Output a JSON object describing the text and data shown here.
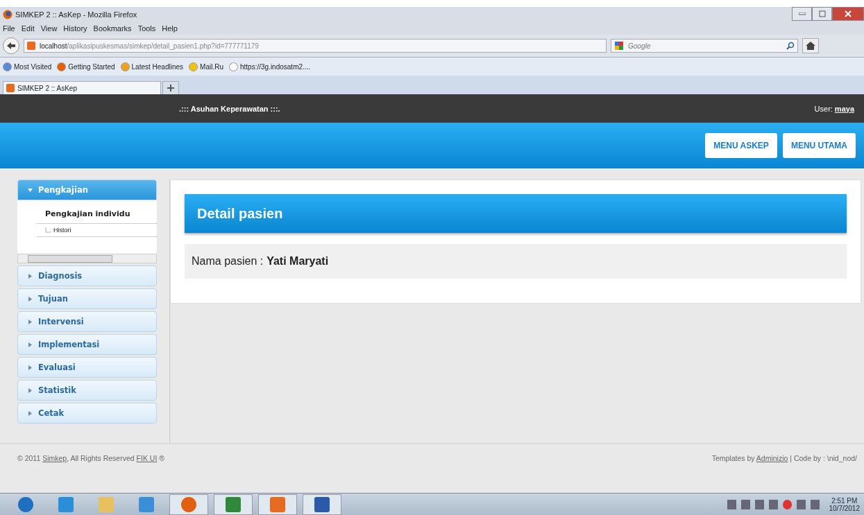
{
  "window": {
    "title": "SIMKEP 2 :: AsKep - Mozilla Firefox"
  },
  "menu": [
    "File",
    "Edit",
    "View",
    "History",
    "Bookmarks",
    "Tools",
    "Help"
  ],
  "address": {
    "host": "localhost",
    "path": "/aplikasipuskesmas/simkep/detail_pasien1.php?id=777771179"
  },
  "search": {
    "placeholder": "Google"
  },
  "bookmarks": [
    "Most Visited",
    "Getting Started",
    "Latest Headlines",
    "Mail.Ru",
    "https://3g.indosatm2...."
  ],
  "tabs": [
    {
      "label": "SIMKEP 2 :: AsKep",
      "selected": true
    }
  ],
  "header": {
    "title": ".::: Asuhan Keperawatan :::.",
    "user_label": "User:",
    "user": "maya"
  },
  "buttons": [
    "MENU ASKEP",
    "MENU UTAMA"
  ],
  "sidebar": {
    "sections": [
      {
        "label": "Pengkajian",
        "expanded": true,
        "children": [
          {
            "label": "Pengkajian individu",
            "children": [
              {
                "label": "Histori"
              }
            ]
          }
        ]
      },
      {
        "label": "Diagnosis",
        "expanded": false
      },
      {
        "label": "Tujuan",
        "expanded": false
      },
      {
        "label": "Intervensi",
        "expanded": false
      },
      {
        "label": "Implementasi",
        "expanded": false
      },
      {
        "label": "Evaluasi",
        "expanded": false
      },
      {
        "label": "Statistik",
        "expanded": false
      },
      {
        "label": "Cetak",
        "expanded": false
      }
    ]
  },
  "panel": {
    "title": "Detail pasien",
    "field_label": "Nama pasien :",
    "field_value": "Yati Maryati"
  },
  "footer": {
    "left": [
      {
        "kind": "text",
        "text": "© 2011 "
      },
      {
        "kind": "link",
        "text": "Simkep"
      },
      {
        "kind": "text",
        "text": ", All Rights Reserved "
      },
      {
        "kind": "link",
        "text": "FIK UI"
      },
      {
        "kind": "text",
        "text": " ®"
      }
    ],
    "right": [
      {
        "kind": "text",
        "text": "Templates by "
      },
      {
        "kind": "link",
        "text": "Adminizio"
      },
      {
        "kind": "text",
        "text": " | Code by : \\nid_nod/"
      }
    ]
  },
  "taskbar": {
    "time": "2:51 PM",
    "date": "10/7/2012"
  }
}
